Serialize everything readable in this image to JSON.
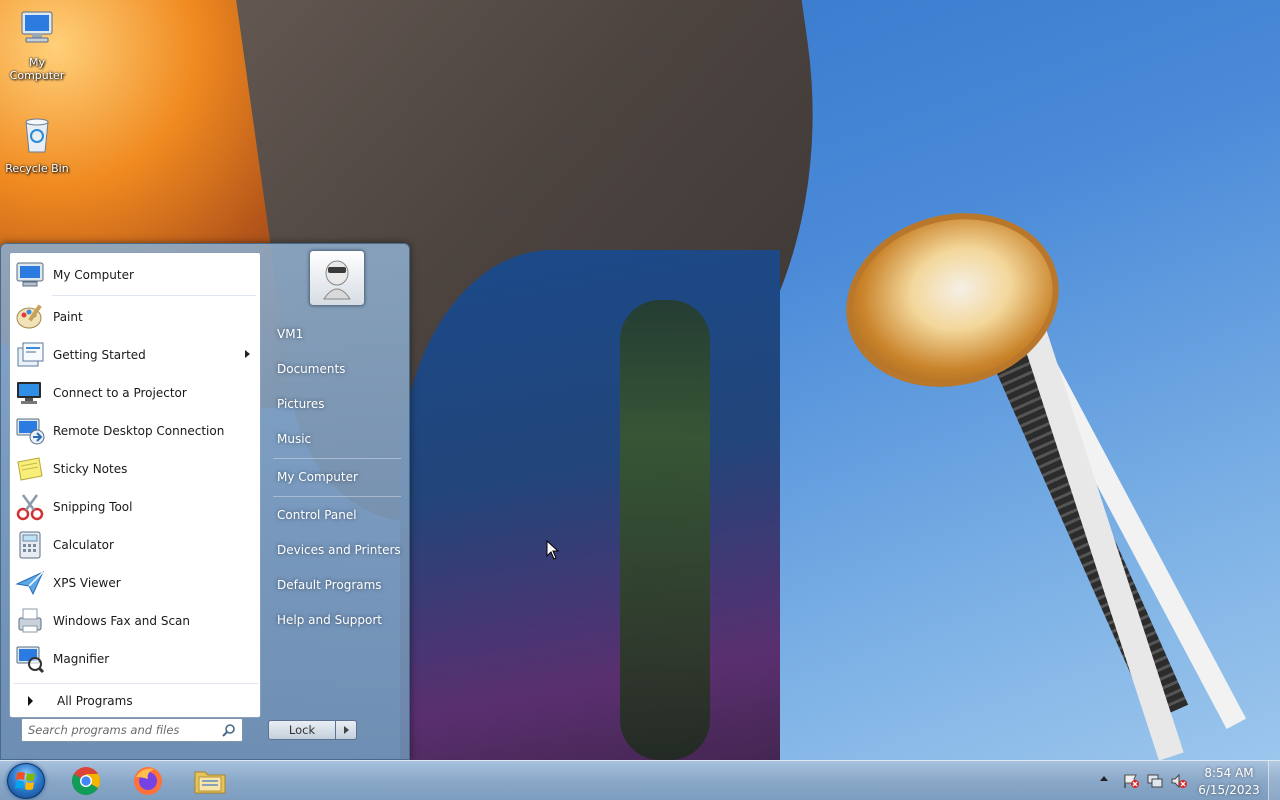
{
  "desktop": {
    "icons": [
      {
        "label": "My Computer"
      },
      {
        "label": "Recycle Bin"
      }
    ]
  },
  "start_menu": {
    "programs": [
      {
        "label": "My Computer",
        "icon": "computer-icon"
      },
      {
        "label": "Paint",
        "icon": "paint-icon"
      },
      {
        "label": "Getting Started",
        "icon": "getting-started-icon",
        "has_submenu": true
      },
      {
        "label": "Connect to a Projector",
        "icon": "projector-icon"
      },
      {
        "label": "Remote Desktop Connection",
        "icon": "remote-desktop-icon"
      },
      {
        "label": "Sticky Notes",
        "icon": "sticky-notes-icon"
      },
      {
        "label": "Snipping Tool",
        "icon": "snipping-tool-icon"
      },
      {
        "label": "Calculator",
        "icon": "calculator-icon"
      },
      {
        "label": "XPS Viewer",
        "icon": "xps-viewer-icon"
      },
      {
        "label": "Windows Fax and Scan",
        "icon": "fax-scan-icon"
      },
      {
        "label": "Magnifier",
        "icon": "magnifier-icon"
      }
    ],
    "all_programs": "All Programs",
    "search": {
      "placeholder": "Search programs and files",
      "value": ""
    },
    "right_items": [
      {
        "label": "VM1"
      },
      {
        "label": "Documents"
      },
      {
        "label": "Pictures"
      },
      {
        "label": "Music"
      },
      {
        "label": "My Computer"
      },
      {
        "label": "Control Panel"
      },
      {
        "label": "Devices and Printers"
      },
      {
        "label": "Default Programs"
      },
      {
        "label": "Help and Support"
      }
    ],
    "lock_label": "Lock"
  },
  "taskbar": {
    "apps": [
      {
        "name": "chrome-icon"
      },
      {
        "name": "firefox-icon"
      },
      {
        "name": "file-explorer-icon"
      }
    ],
    "clock": {
      "time": "8:54 AM",
      "date": "6/15/2023"
    }
  },
  "colors": {
    "accent": "#2f7fd0",
    "taskbar": "#8aa8c8"
  }
}
